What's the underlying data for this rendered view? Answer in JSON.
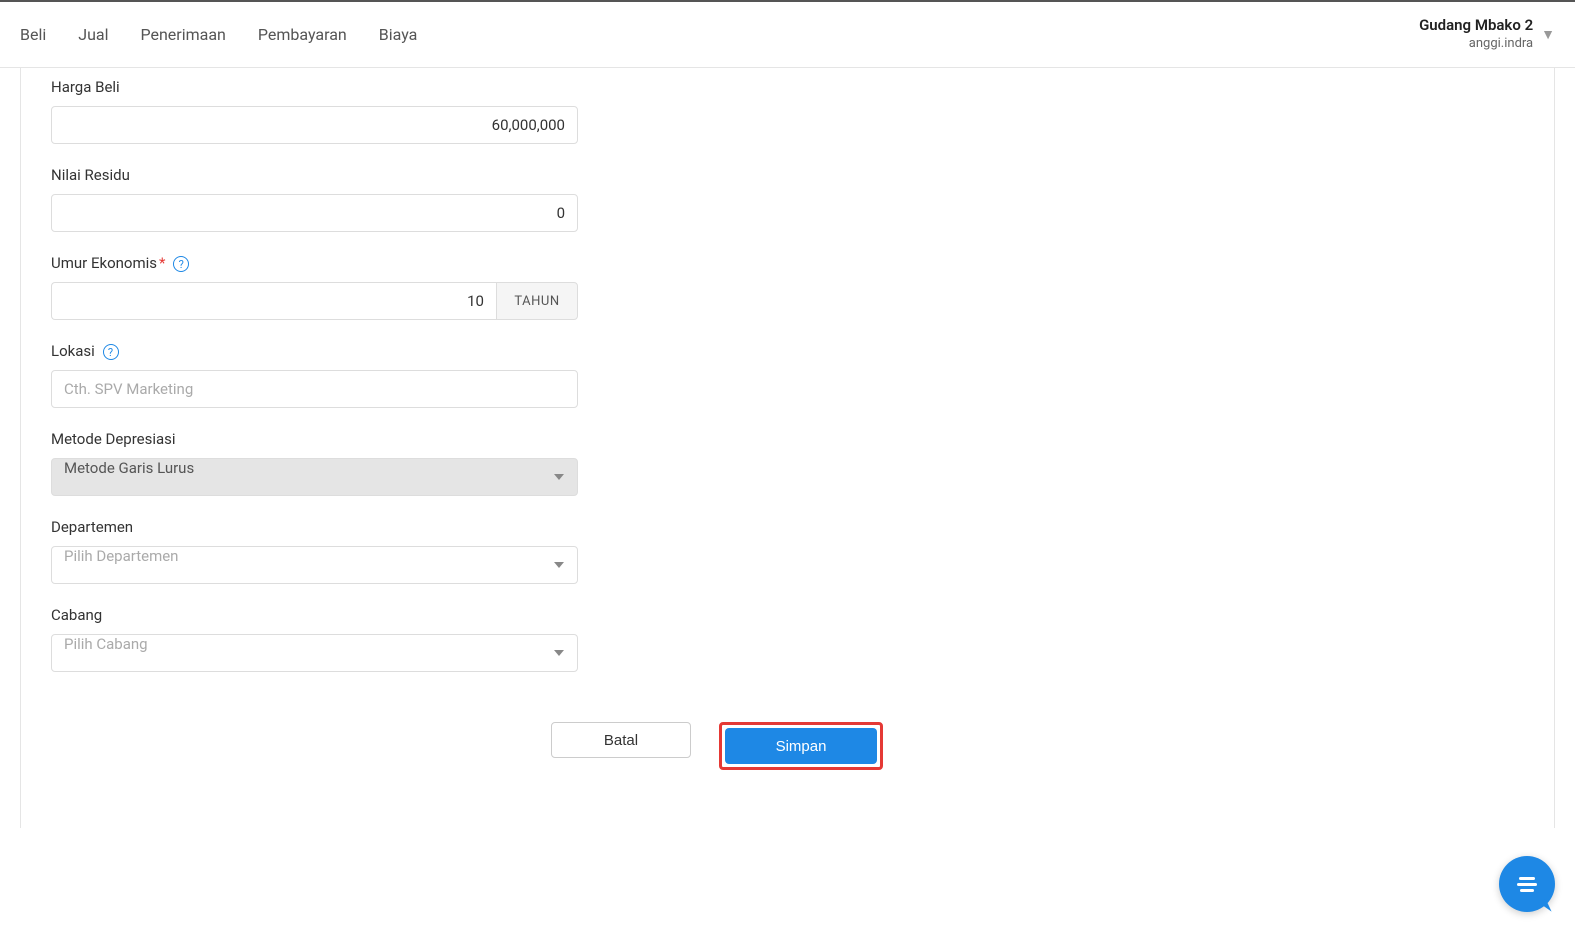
{
  "header": {
    "nav": [
      "Beli",
      "Jual",
      "Penerimaan",
      "Pembayaran",
      "Biaya"
    ],
    "company_name": "Gudang Mbako 2",
    "user_email": "anggi.indra"
  },
  "form": {
    "harga_beli": {
      "label": "Harga Beli",
      "value": "60,000,000"
    },
    "nilai_residu": {
      "label": "Nilai Residu",
      "value": "0"
    },
    "umur_ekonomis": {
      "label": "Umur Ekonomis",
      "value": "10",
      "unit": "TAHUN"
    },
    "lokasi": {
      "label": "Lokasi",
      "placeholder": "Cth. SPV Marketing"
    },
    "metode_depresiasi": {
      "label": "Metode Depresiasi",
      "value": "Metode Garis Lurus"
    },
    "departemen": {
      "label": "Departemen",
      "placeholder": "Pilih Departemen"
    },
    "cabang": {
      "label": "Cabang",
      "placeholder": "Pilih Cabang"
    }
  },
  "buttons": {
    "cancel": "Batal",
    "save": "Simpan"
  }
}
